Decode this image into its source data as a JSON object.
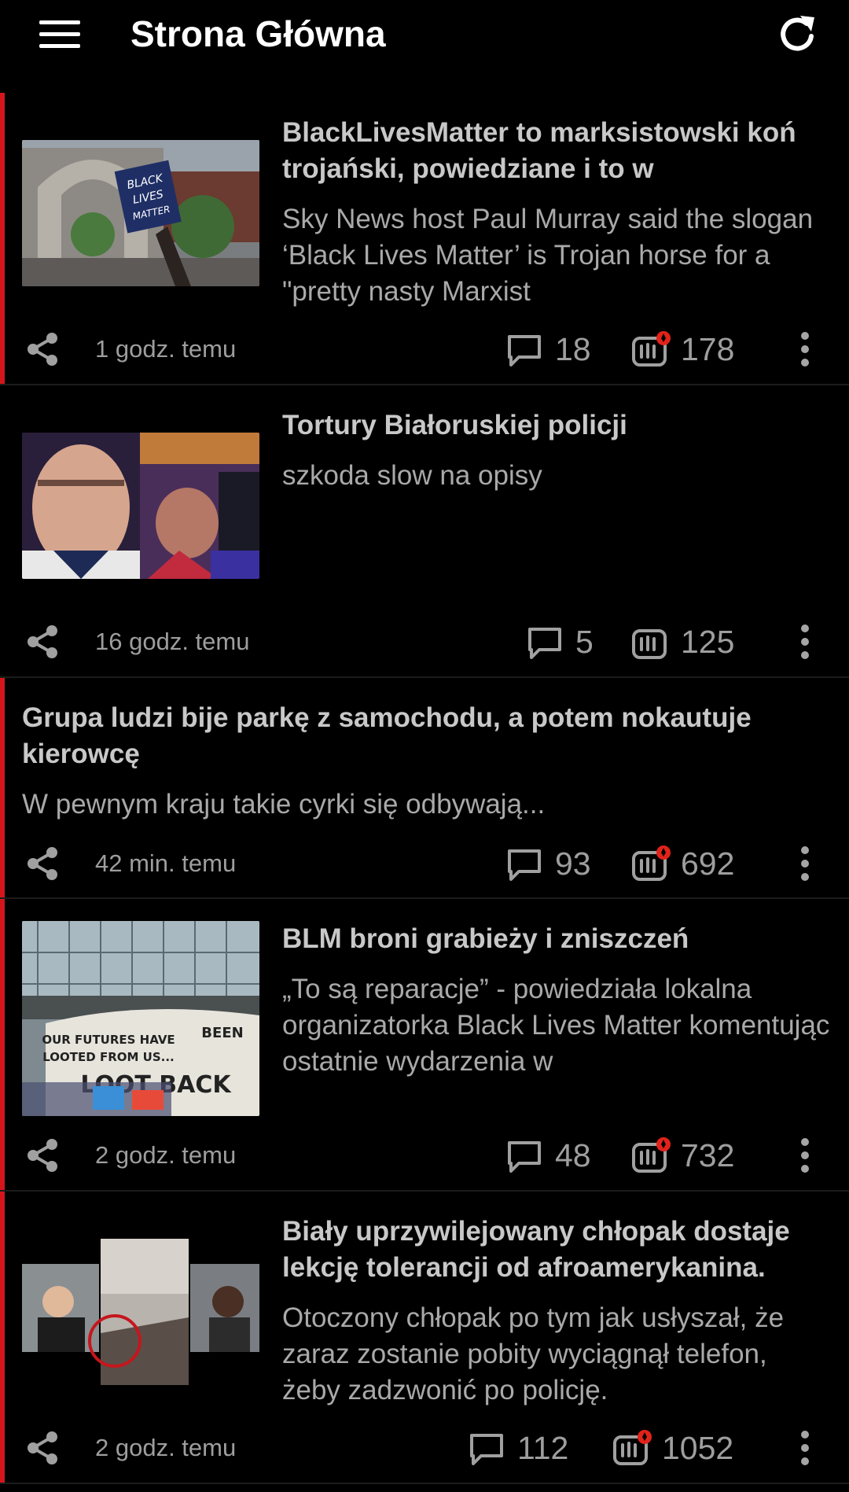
{
  "appbar": {
    "title": "Strona Główna",
    "menu_icon": "hamburger-menu-icon",
    "refresh_icon": "refresh-icon"
  },
  "colors": {
    "background": "#000000",
    "unread_accent": "#d4161c",
    "text_primary": "#c8c8c8",
    "text_secondary": "#9e9e9e",
    "hot_badge": "#e2231a"
  },
  "feed": [
    {
      "title": "BlackLivesMatter to marksistowski koń trojański, powiedziane i to w",
      "description": "Sky News host Paul Murray said the slogan ‘Black Lives Matter’ is Trojan horse for a \"pretty nasty Marxist",
      "time": "1 godz. temu",
      "comments": "18",
      "votes": "178",
      "hot": true,
      "unread": true,
      "has_thumbnail": true,
      "thumbnail_text": "BLACK LIVES MATTER"
    },
    {
      "title": "Tortury Białoruskiej policji",
      "description": "szkoda slow na opisy",
      "time": "16 godz. temu",
      "comments": "5",
      "votes": "125",
      "hot": false,
      "unread": false,
      "has_thumbnail": true
    },
    {
      "title": "Grupa ludzi bije parkę z samochodu, a potem nokautuje kierowcę",
      "description": "W pewnym kraju takie cyrki się odbywają...",
      "time": "42 min. temu",
      "comments": "93",
      "votes": "692",
      "hot": true,
      "unread": true,
      "has_thumbnail": false
    },
    {
      "title": "BLM broni grabieży i zniszczeń",
      "description": "„To są reparacje” - powiedziała lokalna organizatorka Black Lives Matter komentując ostatnie wydarzenia w",
      "time": "2 godz. temu",
      "comments": "48",
      "votes": "732",
      "hot": true,
      "unread": true,
      "has_thumbnail": true,
      "thumbnail_text_1": "OUR FUTURES HAVE BEEN",
      "thumbnail_text_2": "LOOTED FROM US...",
      "thumbnail_text_3": "LOOT BACK"
    },
    {
      "title": "Biały uprzywilejowany chłopak dostaje lekcję tolerancji od afroamerykanina.",
      "description": "Otoczony chłopak po tym jak usłyszał, że zaraz zostanie pobity wyciągnął telefon, żeby zadzwonić po policję.",
      "time": "2 godz. temu",
      "comments": "112",
      "votes": "1052",
      "hot": true,
      "unread": true,
      "has_thumbnail": true
    }
  ]
}
